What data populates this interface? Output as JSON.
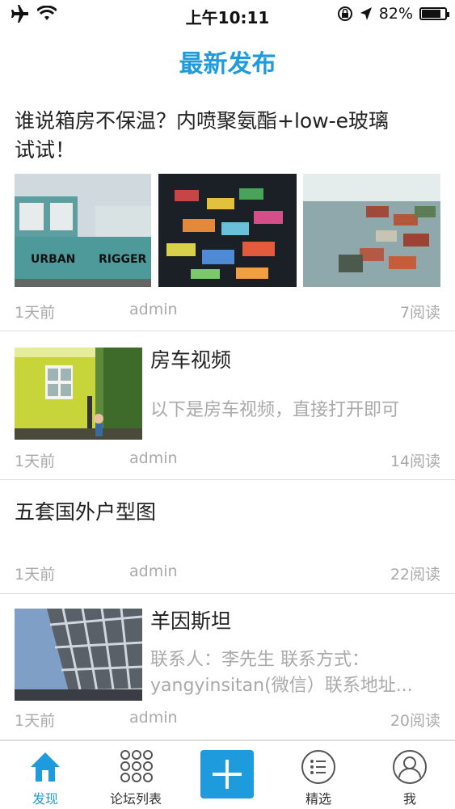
{
  "status": {
    "time": "上午10:11",
    "battery": "82%",
    "battery_level": 0.82
  },
  "page_title": "最新发布",
  "posts": [
    {
      "title_line1": "谁说箱房不保温？内喷聚氨酯+low-e玻璃",
      "title_line2": "试试！",
      "date": "1天前",
      "author": "admin",
      "reads": "7阅读",
      "image_text_a": "URBAN",
      "image_text_b": "RIGGER"
    },
    {
      "title": "房车视频",
      "desc": "以下是房车视频，直接打开即可",
      "date": "1天前",
      "author": "admin",
      "reads": "14阅读"
    },
    {
      "title": "五套国外户型图",
      "date": "1天前",
      "author": "admin",
      "reads": "22阅读"
    },
    {
      "title": "羊因斯坦",
      "desc_line1": "联系人：李先生  联系方式：",
      "desc_line2": "yangyinsitan(微信）联系地址...",
      "date": "1天前",
      "author": "admin",
      "reads": "20阅读"
    }
  ],
  "tabs": [
    {
      "label": "发现",
      "icon": "home-icon",
      "active": true
    },
    {
      "label": "论坛列表",
      "icon": "grid-dots-icon"
    },
    {
      "label": "",
      "icon": "plus-icon"
    },
    {
      "label": "精选",
      "icon": "list-icon"
    },
    {
      "label": "我",
      "icon": "user-icon"
    }
  ],
  "colors": {
    "accent": "#1e9bdc",
    "muted": "#aaaaaa"
  }
}
